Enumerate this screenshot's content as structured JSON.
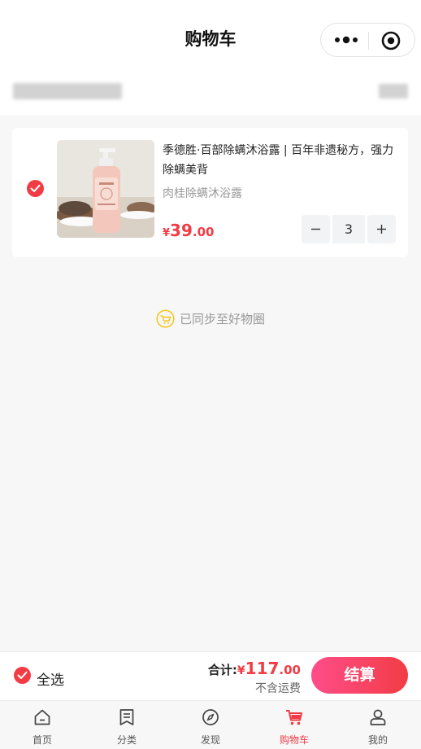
{
  "nav": {
    "title": "购物车",
    "more_icon": "more-dots-icon",
    "close_icon": "target-circle-icon"
  },
  "cart": {
    "items": [
      {
        "checked": true,
        "title": "季德胜·百部除螨沐浴露 | 百年非遗秘方，强力除螨美背",
        "spec": "肉桂除螨沐浴露",
        "price_symbol": "¥",
        "price_int": "39",
        "price_dec": ".00",
        "quantity": "3"
      }
    ],
    "sync_text": "已同步至好物圈"
  },
  "checkout": {
    "select_all_label": "全选",
    "total_label": "合计:",
    "total_symbol": "¥",
    "total_int": "117",
    "total_dec": ".00",
    "shipping_note": "不含运费",
    "pay_label": "结算"
  },
  "tabbar": {
    "items": [
      {
        "label": "首页",
        "icon": "home-icon"
      },
      {
        "label": "分类",
        "icon": "category-icon"
      },
      {
        "label": "发现",
        "icon": "compass-icon"
      },
      {
        "label": "购物车",
        "icon": "cart-icon",
        "active": true
      },
      {
        "label": "我的",
        "icon": "user-icon"
      }
    ]
  },
  "colors": {
    "accent": "#f23c45",
    "gradient_start": "#ff4d8a",
    "sync_icon": "#f5c518"
  }
}
